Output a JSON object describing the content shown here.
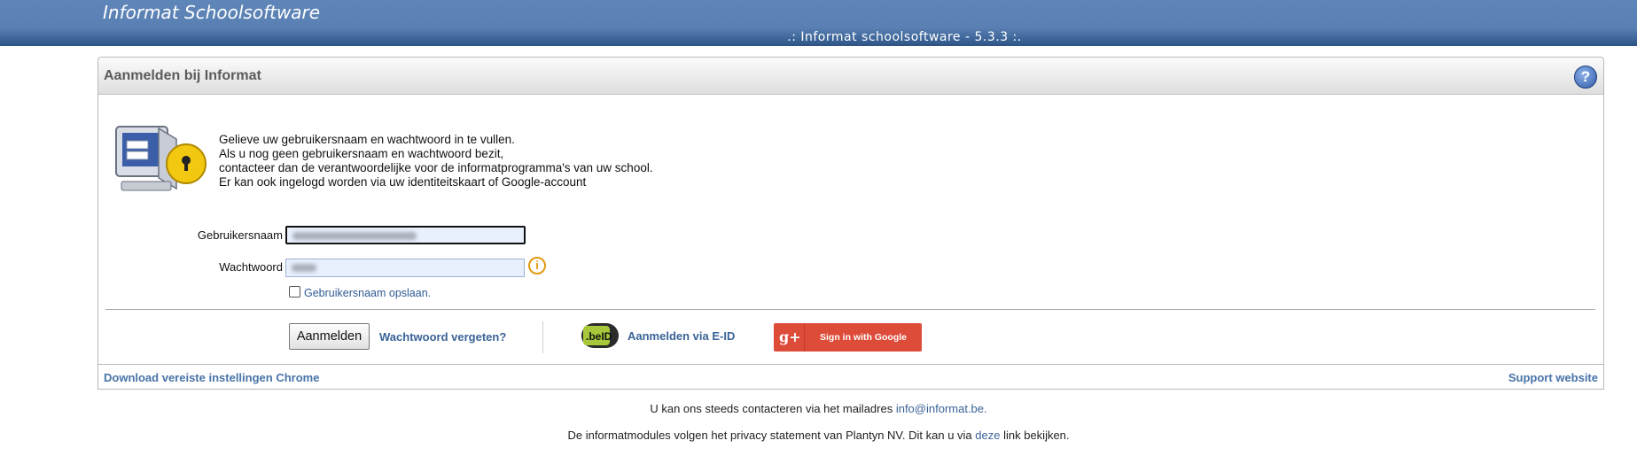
{
  "header": {
    "app_title": "Informat Schoolsoftware",
    "version": ".: Informat schoolsoftware - 5.3.3 :."
  },
  "panel": {
    "title": "Aanmelden bij Informat",
    "help_icon": "?",
    "intro_lines": [
      "Gelieve uw gebruikersnaam en wachtwoord in te vullen.",
      "Als u nog geen gebruikersnaam en wachtwoord bezit,",
      "contacteer dan de verantwoordelijke voor de informatprogramma's van uw school.",
      "Er kan ook ingelogd worden via uw identiteitskaart of Google-account"
    ]
  },
  "form": {
    "username_label": "Gebruikersnaam",
    "username_value": "",
    "password_label": "Wachtwoord",
    "password_value": "",
    "info_icon": "i",
    "remember_label": "Gebruikersnaam opslaan.",
    "remember_checked": false
  },
  "actions": {
    "login_button": "Aanmelden",
    "forgot_password": "Wachtwoord vergeten?",
    "eid_badge": ".beID",
    "eid_login": "Aanmelden via E-ID",
    "google_icon": "g+",
    "google_button": "Sign in with Google"
  },
  "footer_links": {
    "chrome_settings": "Download vereiste instellingen Chrome",
    "support": "Support website"
  },
  "bottom": {
    "contact_text": "U kan ons steeds contacteren via het mailadres ",
    "contact_email": "info@informat.be.",
    "privacy_text": "De informatmodules volgen het privacy statement van Plantyn NV. Dit kan u via ",
    "privacy_link": "deze",
    "privacy_suffix": " link bekijken."
  },
  "icons": {
    "help": "help-icon",
    "computer_lock": "computer-lock-icon",
    "info": "info-icon",
    "beid": "beid-icon",
    "google_plus": "google-plus-icon"
  },
  "colors": {
    "header_bar": "#5a80b3",
    "link": "#3a6397",
    "google_button": "#dd4b39"
  }
}
